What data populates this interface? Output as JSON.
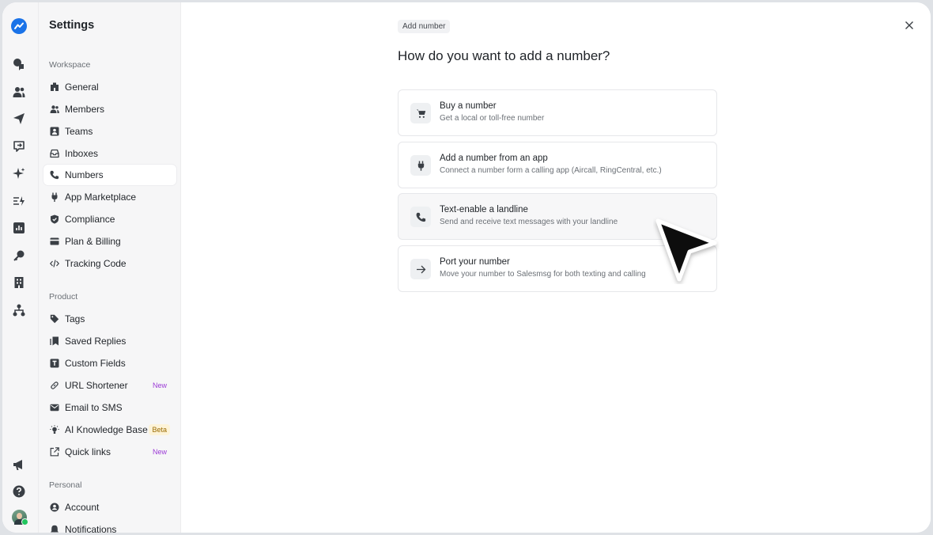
{
  "sidebar": {
    "title": "Settings",
    "sections": {
      "workspace": "Workspace",
      "product": "Product",
      "personal": "Personal"
    },
    "workspace_items": [
      {
        "label": "General",
        "icon": "building-icon"
      },
      {
        "label": "Members",
        "icon": "members-icon"
      },
      {
        "label": "Teams",
        "icon": "teams-icon"
      },
      {
        "label": "Inboxes",
        "icon": "inbox-icon"
      },
      {
        "label": "Numbers",
        "icon": "phone-icon",
        "active": true
      },
      {
        "label": "App Marketplace",
        "icon": "plug-icon"
      },
      {
        "label": "Compliance",
        "icon": "shield-icon"
      },
      {
        "label": "Plan & Billing",
        "icon": "credit-card-icon"
      },
      {
        "label": "Tracking Code",
        "icon": "code-icon"
      }
    ],
    "product_items": [
      {
        "label": "Tags",
        "icon": "tag-icon"
      },
      {
        "label": "Saved Replies",
        "icon": "saved-replies-icon"
      },
      {
        "label": "Custom Fields",
        "icon": "custom-field-icon"
      },
      {
        "label": "URL Shortener",
        "icon": "link-icon",
        "badge": "New"
      },
      {
        "label": "Email to SMS",
        "icon": "mail-icon"
      },
      {
        "label": "AI Knowledge Base",
        "icon": "bulb-icon",
        "badge": "Beta"
      },
      {
        "label": "Quick links",
        "icon": "external-link-icon",
        "badge": "New"
      }
    ],
    "personal_items": [
      {
        "label": "Account",
        "icon": "account-icon"
      },
      {
        "label": "Notifications",
        "icon": "bell-icon"
      }
    ]
  },
  "main": {
    "chip": "Add number",
    "heading": "How do you want to add a number?",
    "options": [
      {
        "title": "Buy a number",
        "desc": "Get a local or toll-free number",
        "icon": "cart-icon"
      },
      {
        "title": "Add a number from an app",
        "desc": "Connect a number form a calling app (Aircall, RingCentral, etc.)",
        "icon": "plug-icon"
      },
      {
        "title": "Text-enable a landline",
        "desc": "Send and receive text messages with your landline",
        "icon": "phone-icon"
      },
      {
        "title": "Port your number",
        "desc": "Move your number to Salesmsg for both texting and calling",
        "icon": "arrow-right-icon"
      }
    ]
  },
  "colors": {
    "brand": "#1a73e8",
    "new_badge": "#9b3ad6",
    "beta_badge": "#9a6a00"
  }
}
